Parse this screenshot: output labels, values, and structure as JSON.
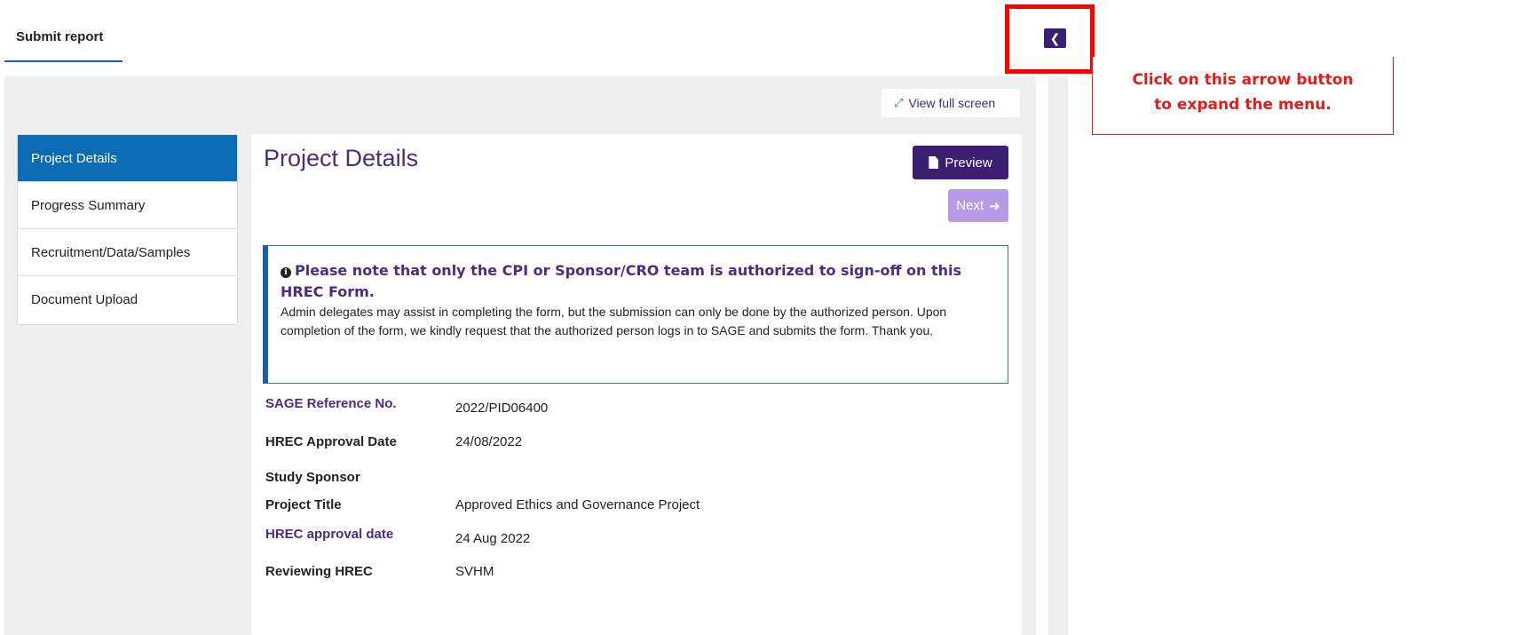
{
  "tab": {
    "label": "Submit report"
  },
  "toolbar": {
    "fullscreen_label": "View full screen"
  },
  "callout": {
    "line1": "Click on this arrow button",
    "line2": "to expand the menu."
  },
  "nav": {
    "items": [
      {
        "label": "Project Details"
      },
      {
        "label": "Progress Summary"
      },
      {
        "label": "Recruitment/Data/Samples"
      },
      {
        "label": "Document Upload"
      }
    ]
  },
  "content": {
    "title": "Project Details",
    "preview_label": "Preview",
    "next_label": "Next",
    "notice": {
      "title": "Please note that only the CPI or Sponsor/CRO team is authorized to sign-off on this HREC Form.",
      "body": "Admin delegates may assist in completing the form, but the submission can only be done by the authorized person. Upon completion of the form, we kindly request that the authorized person logs in to SAGE and submits the form. Thank you."
    },
    "fields": [
      {
        "label": "SAGE Reference No.",
        "value": "2022/PID06400"
      },
      {
        "label": "HREC Approval Date",
        "value": "24/08/2022"
      },
      {
        "label": "Study Sponsor",
        "value": ""
      },
      {
        "label": "Project Title",
        "value": "Approved Ethics and Governance Project"
      },
      {
        "label": "HREC approval date",
        "value": "24 Aug 2022"
      },
      {
        "label": "Reviewing HREC",
        "value": "SVHM"
      }
    ]
  },
  "colors": {
    "primary": "#3b1f73",
    "nav_active": "#0b6bb5",
    "title": "#4a2d80",
    "next_disabled": "#b79be6",
    "annotation": "#ff0000"
  },
  "icons": {
    "collapse": "chevron-left-icon",
    "fullscreen": "expand-icon",
    "preview": "file-icon",
    "next": "arrow-right-icon",
    "notice": "info-circle-icon"
  }
}
